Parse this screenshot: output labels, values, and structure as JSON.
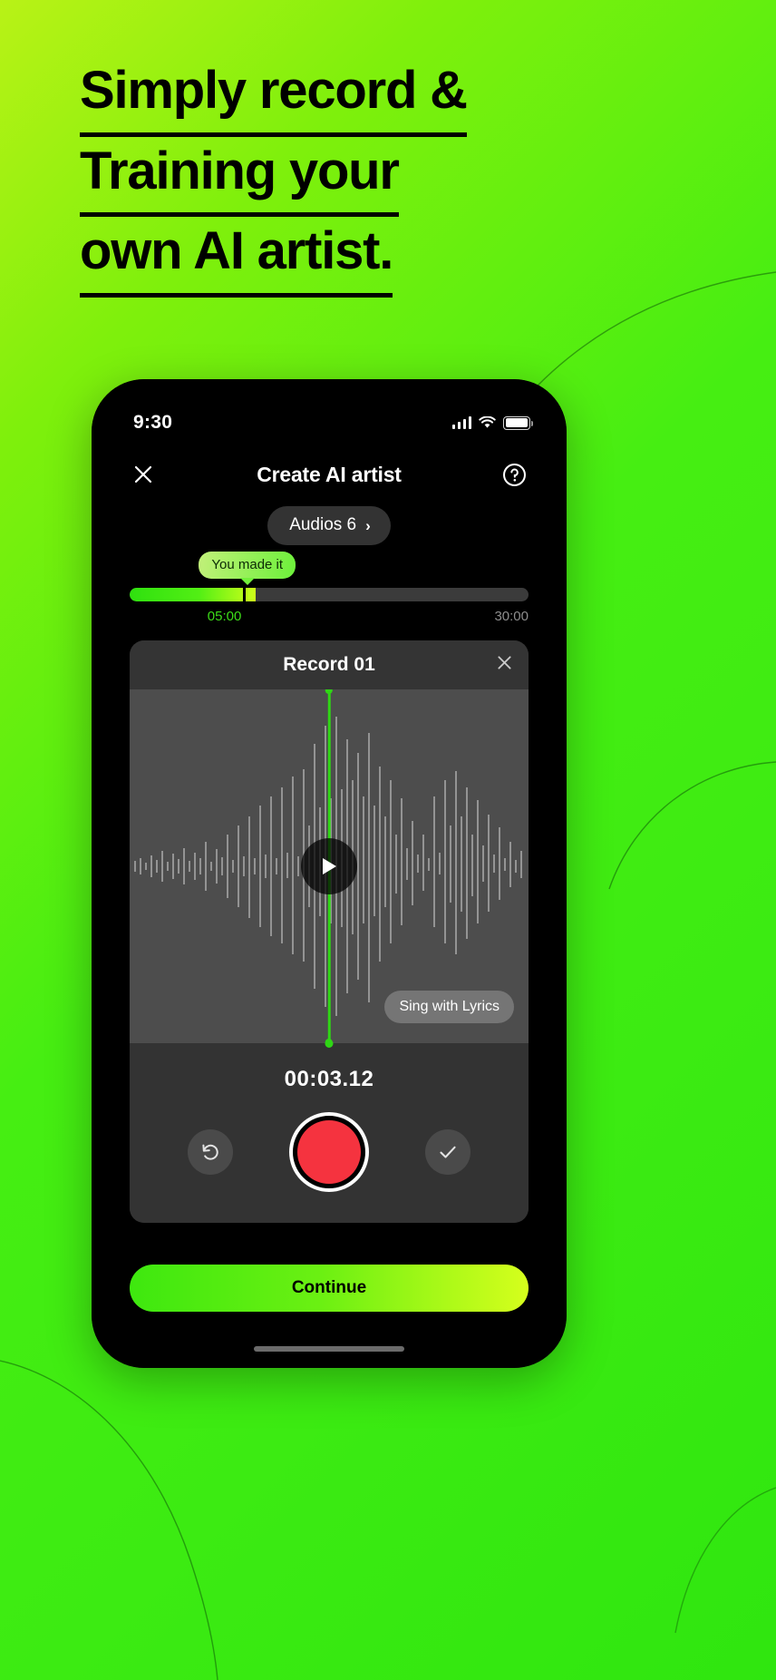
{
  "hero": {
    "headline_lines": [
      "Simply record &",
      "Training your",
      "own AI artist."
    ]
  },
  "colors": {
    "brand_green": "#3ee80f",
    "brand_lime": "#d6ff1c",
    "record_red": "#f5333f",
    "playhead_green": "#2fd615",
    "card_bg": "#2b2b2b",
    "wave_bg": "#4d4d4d"
  },
  "phone": {
    "status_bar": {
      "time": "9:30",
      "signal_icon": "cellular-signal-icon",
      "wifi_icon": "wifi-icon",
      "battery_icon": "battery-icon"
    },
    "navbar": {
      "close_icon": "close-icon",
      "title": "Create AI artist",
      "help_icon": "help-circle-icon"
    },
    "audios_pill": {
      "label": "Audios 6",
      "chevron": "›",
      "chevron_icon": "chevron-right-icon"
    },
    "progress": {
      "badge_label": "You made it",
      "current_label": "05:00",
      "max_label": "30:00",
      "fill_percent": 31.5,
      "marker_percent": 28.5
    },
    "record_card": {
      "title": "Record 01",
      "close_icon": "close-icon",
      "play_icon": "play-icon",
      "lyrics_label": "Sing with Lyrics",
      "timer": "00:03.12",
      "undo_icon": "undo-rotate-left-icon",
      "record_icon": "record-button-icon",
      "confirm_icon": "check-icon"
    },
    "continue_label": "Continue"
  }
}
